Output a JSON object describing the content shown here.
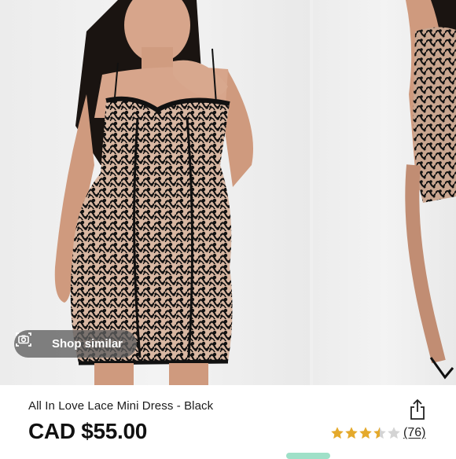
{
  "product": {
    "title": "All In Love Lace Mini Dress - Black",
    "price": "CAD $55.00",
    "rating_value": 3.5,
    "rating_max": 5,
    "review_count": "(76)"
  },
  "actions": {
    "shop_similar_label": "Shop similar",
    "shop_similar_icon": "camera-icon",
    "share_icon": "share-icon"
  },
  "colors": {
    "star_filled": "#e4a92b",
    "star_empty": "#d4d4d4",
    "dress": "#111111",
    "lining": "#d9b9a4",
    "accent_chip": "#9fe0c8"
  }
}
